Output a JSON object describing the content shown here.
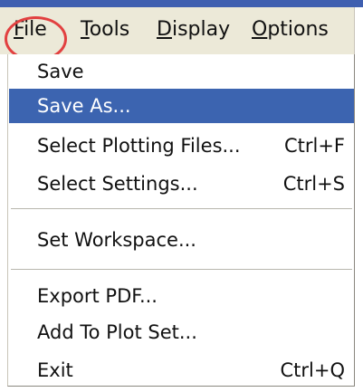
{
  "menubar": {
    "items": [
      {
        "mnemonic": "F",
        "rest": "ile"
      },
      {
        "mnemonic": "T",
        "rest": "ools"
      },
      {
        "mnemonic": "D",
        "rest": "isplay"
      },
      {
        "mnemonic": "O",
        "rest": "ptions"
      }
    ]
  },
  "file_menu": {
    "items": [
      {
        "label": "Save",
        "shortcut": ""
      },
      {
        "label": "Save As...",
        "shortcut": ""
      },
      {
        "label": "Select Plotting Files...",
        "shortcut": "Ctrl+F"
      },
      {
        "label": "Select Settings...",
        "shortcut": "Ctrl+S"
      },
      {
        "label": "Set Workspace...",
        "shortcut": ""
      },
      {
        "label": "Export PDF...",
        "shortcut": ""
      },
      {
        "label": "Add To Plot Set...",
        "shortcut": ""
      },
      {
        "label": "Exit",
        "shortcut": "Ctrl+Q"
      }
    ],
    "selected_index": 1
  },
  "colors": {
    "title_strip": "#3f5fb0",
    "menubar_bg": "#ece9d8",
    "selection_bg": "#3c64b0",
    "highlight_circle": "#e24040"
  }
}
